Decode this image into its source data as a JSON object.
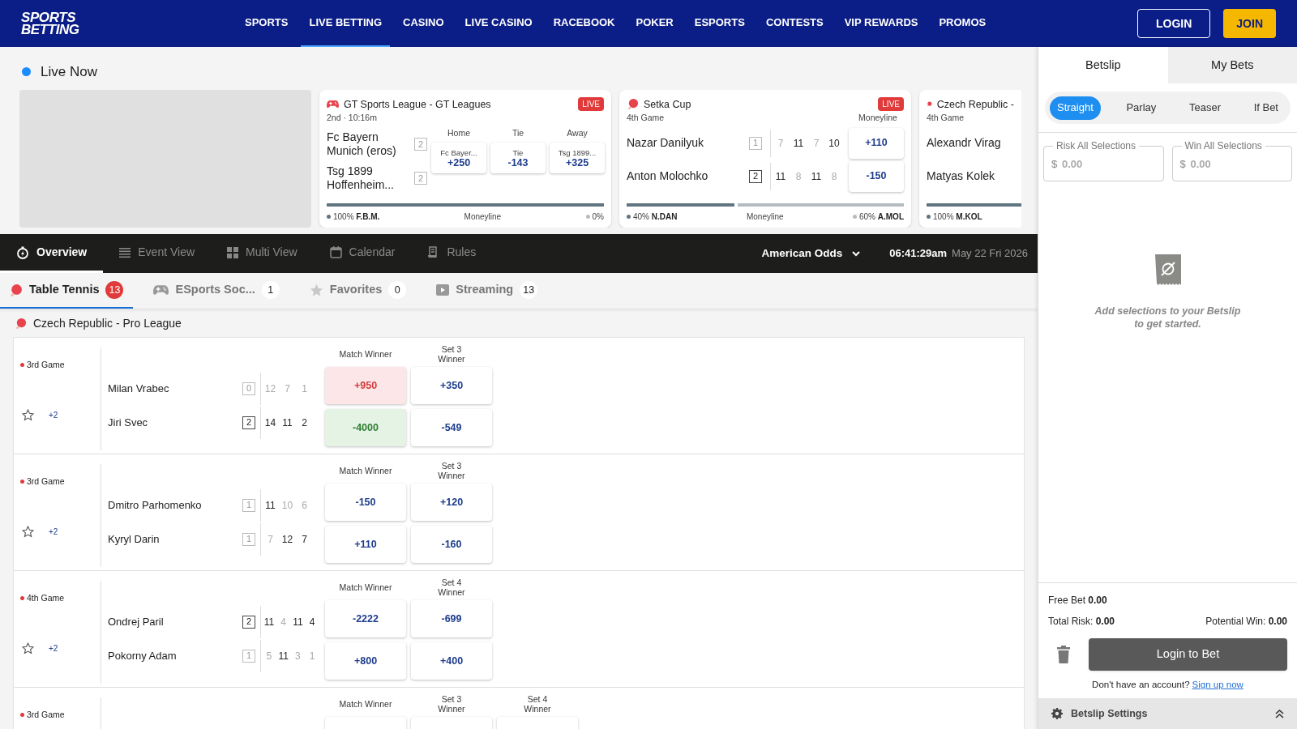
{
  "header": {
    "logo": [
      "SPORTS",
      "BETTING"
    ],
    "nav": [
      {
        "label": "SPORTS",
        "selected": false
      },
      {
        "label": "LIVE BETTING",
        "selected": true
      },
      {
        "label": "CASINO",
        "selected": false
      },
      {
        "label": "LIVE CASINO",
        "selected": false
      },
      {
        "label": "RACEBOOK",
        "selected": false
      },
      {
        "label": "POKER",
        "selected": false
      },
      {
        "label": "ESPORTS",
        "selected": false
      },
      {
        "label": "CONTESTS",
        "selected": false
      },
      {
        "label": "VIP REWARDS",
        "selected": false
      },
      {
        "label": "PROMOS",
        "selected": false
      }
    ],
    "login": "LOGIN",
    "join": "JOIN"
  },
  "live_now": {
    "title": "Live Now",
    "cards": [
      {
        "kind": "three-way",
        "league": "GT Sports League - GT Leagues",
        "period": "2nd · 10:16m",
        "badge": "LIVE",
        "players": [
          {
            "name": "Fc Bayern Munich (eros)",
            "sets": "2",
            "leading": false
          },
          {
            "name": "Tsg 1899 Hoffenheim...",
            "sets": "2",
            "leading": false
          }
        ],
        "columns": [
          {
            "header": "Home",
            "label": "Fc Bayer...",
            "odds": "+250"
          },
          {
            "header": "Tie",
            "label": "Tie",
            "odds": "-143"
          },
          {
            "header": "Away",
            "label": "Tsg 1899...",
            "odds": "+325"
          }
        ],
        "level": 1,
        "left": {
          "pct": "100%",
          "abbr": "F.B.M."
        },
        "market": "Moneyline",
        "right": {
          "pct": "0%"
        }
      },
      {
        "kind": "two-way",
        "league": "Setka Cup",
        "period": "4th Game",
        "badge": "LIVE",
        "odds_header": "Moneyline",
        "players": [
          {
            "name": "Nazar Danilyuk",
            "sets": "1",
            "leading": false,
            "scores": [
              {
                "value": "7",
                "won": false
              },
              {
                "value": "11",
                "won": true
              },
              {
                "value": "7",
                "won": false
              },
              {
                "value": "10",
                "won": true
              }
            ],
            "odds": "+110"
          },
          {
            "name": "Anton Molochko",
            "sets": "2",
            "leading": true,
            "scores": [
              {
                "value": "11",
                "won": true
              },
              {
                "value": "8",
                "won": false
              },
              {
                "value": "11",
                "won": true
              },
              {
                "value": "8",
                "won": false
              }
            ],
            "odds": "-150"
          }
        ],
        "level": 0.4,
        "left": {
          "pct": "40%",
          "abbr": "N.DAN"
        },
        "market": "Moneyline",
        "right": {
          "pct": "60%",
          "abbr": "A.MOL"
        }
      },
      {
        "kind": "clipped",
        "league": "Czech Republic -",
        "period": "4th Game",
        "players": [
          {
            "name": "Alexandr Virag"
          },
          {
            "name": "Matyas Kolek"
          }
        ],
        "level": 1,
        "left": {
          "pct": "100%",
          "abbr": "M.KOL"
        }
      }
    ]
  },
  "view_bar": {
    "items": [
      {
        "label": "Overview",
        "kind": "stopwatch",
        "selected": true
      },
      {
        "label": "Event View",
        "kind": "lines",
        "selected": false
      },
      {
        "label": "Multi View",
        "kind": "grid",
        "selected": false
      },
      {
        "label": "Calendar",
        "kind": "calendar",
        "selected": false
      },
      {
        "label": "Rules",
        "kind": "document",
        "selected": false
      }
    ],
    "odds_format": "American Odds",
    "time": "06:41:29am",
    "date": "May 22 Fri 2026"
  },
  "sport_tabs": [
    {
      "kind": "table-tennis",
      "label": "Table Tennis",
      "count": "13",
      "selected": true
    },
    {
      "kind": "controller",
      "label": "ESports Soc...",
      "count": "1",
      "selected": false
    },
    {
      "kind": "star",
      "label": "Favorites",
      "count": "0",
      "selected": false
    },
    {
      "kind": "video",
      "label": "Streaming",
      "count": "13",
      "selected": false
    }
  ],
  "league": {
    "title": "Czech Republic - Pro League",
    "matches": [
      {
        "game": "3rd Game",
        "more": "+2",
        "players": [
          {
            "name": "Milan Vrabec",
            "sets": "0",
            "leading": false,
            "scores": [
              {
                "value": "12",
                "won": false
              },
              {
                "value": "7",
                "won": false
              },
              {
                "value": "1",
                "won": false
              }
            ]
          },
          {
            "name": "Jiri Svec",
            "sets": "2",
            "leading": true,
            "scores": [
              {
                "value": "14",
                "won": true
              },
              {
                "value": "11",
                "won": true
              },
              {
                "value": "2",
                "won": true
              }
            ]
          }
        ],
        "markets": [
          {
            "header": [
              "Match Winner"
            ],
            "odds": [
              {
                "value": "+950",
                "kind": "red"
              },
              {
                "value": "-4000",
                "kind": "green"
              }
            ]
          },
          {
            "header": [
              "Set 3",
              "Winner"
            ],
            "odds": [
              {
                "value": "+350",
                "kind": "plain"
              },
              {
                "value": "-549",
                "kind": "plain"
              }
            ]
          }
        ]
      },
      {
        "game": "3rd Game",
        "more": "+2",
        "players": [
          {
            "name": "Dmitro Parhomenko",
            "sets": "1",
            "leading": false,
            "scores": [
              {
                "value": "11",
                "won": true
              },
              {
                "value": "10",
                "won": false
              },
              {
                "value": "6",
                "won": false
              }
            ]
          },
          {
            "name": "Kyryl Darin",
            "sets": "1",
            "leading": false,
            "scores": [
              {
                "value": "7",
                "won": false
              },
              {
                "value": "12",
                "won": true
              },
              {
                "value": "7",
                "won": true
              }
            ]
          }
        ],
        "markets": [
          {
            "header": [
              "Match Winner"
            ],
            "odds": [
              {
                "value": "-150",
                "kind": "plain"
              },
              {
                "value": "+110",
                "kind": "plain"
              }
            ]
          },
          {
            "header": [
              "Set 3",
              "Winner"
            ],
            "odds": [
              {
                "value": "+120",
                "kind": "plain"
              },
              {
                "value": "-160",
                "kind": "plain"
              }
            ]
          }
        ]
      },
      {
        "game": "4th Game",
        "more": "+2",
        "players": [
          {
            "name": "Ondrej Paril",
            "sets": "2",
            "leading": true,
            "scores": [
              {
                "value": "11",
                "won": true
              },
              {
                "value": "4",
                "won": false
              },
              {
                "value": "11",
                "won": true
              },
              {
                "value": "4",
                "won": true
              }
            ]
          },
          {
            "name": "Pokorny Adam",
            "sets": "1",
            "leading": false,
            "scores": [
              {
                "value": "5",
                "won": false
              },
              {
                "value": "11",
                "won": true
              },
              {
                "value": "3",
                "won": false
              },
              {
                "value": "1",
                "won": false
              }
            ]
          }
        ],
        "markets": [
          {
            "header": [
              "Match Winner"
            ],
            "odds": [
              {
                "value": "-2222",
                "kind": "plain"
              },
              {
                "value": "+800",
                "kind": "plain"
              }
            ]
          },
          {
            "header": [
              "Set 4",
              "Winner"
            ],
            "odds": [
              {
                "value": "-699",
                "kind": "plain"
              },
              {
                "value": "+400",
                "kind": "plain"
              }
            ]
          }
        ]
      },
      {
        "game": "3rd Game",
        "markets": [
          {
            "header": [
              "Match Winner"
            ]
          },
          {
            "header": [
              "Set 3",
              "Winner"
            ]
          },
          {
            "header": [
              "Set 4",
              "Winner"
            ]
          }
        ]
      }
    ]
  },
  "betslip": {
    "tabs": [
      {
        "label": "Betslip",
        "selected": true
      },
      {
        "label": "My Bets",
        "selected": false
      }
    ],
    "bet_types": [
      {
        "label": "Straight",
        "selected": true
      },
      {
        "label": "Parlay",
        "selected": false
      },
      {
        "label": "Teaser",
        "selected": false
      },
      {
        "label": "If Bet",
        "selected": false
      }
    ],
    "fields": [
      {
        "label": "Risk All Selections",
        "prefix": "$",
        "placeholder": "0.00"
      },
      {
        "label": "Win All Selections",
        "prefix": "$",
        "placeholder": "0.00"
      }
    ],
    "empty_message": "Add selections to your Betslip to get started.",
    "free_bet": {
      "label": "Free Bet",
      "value": "0.00"
    },
    "total_risk": {
      "label": "Total Risk:",
      "value": "0.00"
    },
    "potential_win": {
      "label": "Potential Win:",
      "value": "0.00"
    },
    "login_button": "Login to Bet",
    "signup_prompt": "Don't have an account?",
    "signup_link": "Sign up now",
    "settings": "Betslip Settings"
  }
}
